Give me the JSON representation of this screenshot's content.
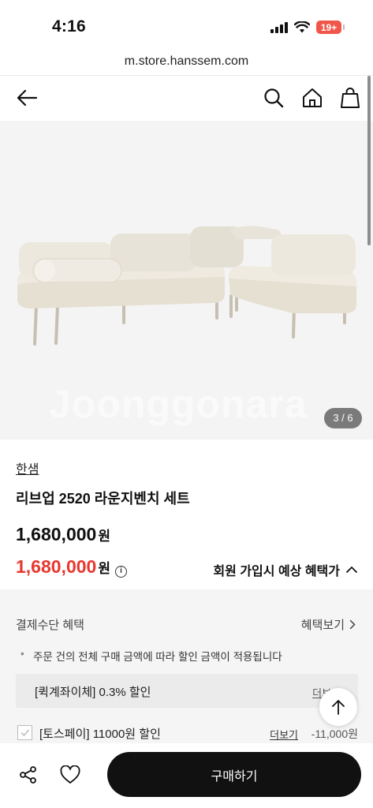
{
  "status_bar": {
    "time": "4:16",
    "battery": "19+"
  },
  "browser": {
    "url": "m.store.hanssem.com"
  },
  "image": {
    "watermark": "Joonggonara",
    "counter": "3 / 6"
  },
  "product": {
    "brand": "한샘",
    "name": "리브업 2520 라운지벤치 세트",
    "price": "1,680,000",
    "price_unit": "원",
    "sale_price": "1,680,000",
    "sale_unit": "원",
    "info_glyph": "i",
    "member_benefit": "회원 가입시 예상 혜택가"
  },
  "payment": {
    "title": "결제수단 혜택",
    "more": "혜택보기",
    "note": "주문 건의 전체 구매 금액에 따라 할인 금액이 적용됩니다",
    "promo_label": "[퀵계좌이체] 0.3% 할인",
    "promo_more": "더보기",
    "toss_label": "[토스페이] 11000원 할인",
    "toss_more": "더보기",
    "toss_discount": "-11,000원"
  },
  "bottom": {
    "buy_label": "구매하기"
  },
  "colors": {
    "sale": "#e8372f",
    "buy_button": "#111111",
    "battery": "#f0564a"
  }
}
